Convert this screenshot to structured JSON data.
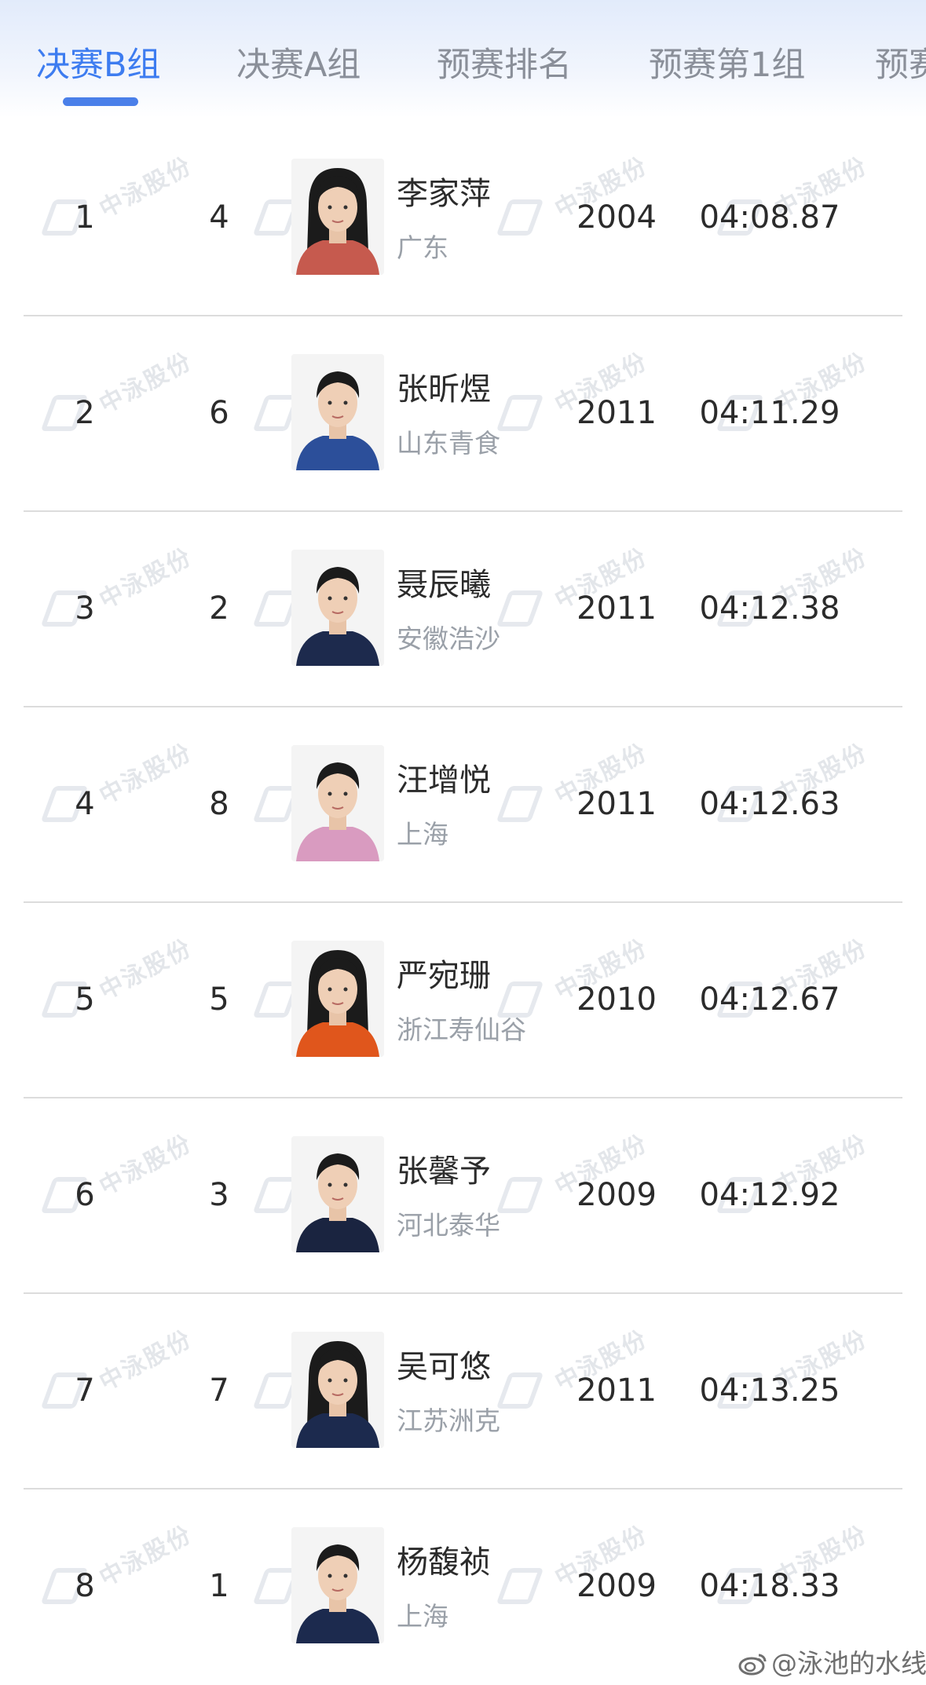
{
  "tabs": [
    {
      "label": "决赛B组",
      "active": true
    },
    {
      "label": "决赛A组",
      "active": false
    },
    {
      "label": "预赛排名",
      "active": false
    },
    {
      "label": "预赛第1组",
      "active": false
    },
    {
      "label": "预赛",
      "active": false
    }
  ],
  "watermark": {
    "text": "中泳股份"
  },
  "rows": [
    {
      "rank": "1",
      "lane": "4",
      "name": "李家萍",
      "team": "广东",
      "year": "2004",
      "time": "04:08.87",
      "shirt": "#c65a4e",
      "hair": "long"
    },
    {
      "rank": "2",
      "lane": "6",
      "name": "张昕煜",
      "team": "山东青食",
      "year": "2011",
      "time": "04:11.29",
      "shirt": "#2c4f9a",
      "hair": "short"
    },
    {
      "rank": "3",
      "lane": "2",
      "name": "聂辰曦",
      "team": "安徽浩沙",
      "year": "2011",
      "time": "04:12.38",
      "shirt": "#1d2a4d",
      "hair": "short"
    },
    {
      "rank": "4",
      "lane": "8",
      "name": "汪增悦",
      "team": "上海",
      "year": "2011",
      "time": "04:12.63",
      "shirt": "#d99bc0",
      "hair": "short"
    },
    {
      "rank": "5",
      "lane": "5",
      "name": "严宛珊",
      "team": "浙江寿仙谷",
      "year": "2010",
      "time": "04:12.67",
      "shirt": "#e0561c",
      "hair": "long"
    },
    {
      "rank": "6",
      "lane": "3",
      "name": "张馨予",
      "team": "河北泰华",
      "year": "2009",
      "time": "04:12.92",
      "shirt": "#1a2440",
      "hair": "short"
    },
    {
      "rank": "7",
      "lane": "7",
      "name": "吴可悠",
      "team": "江苏洲克",
      "year": "2011",
      "time": "04:13.25",
      "shirt": "#1c2a4e",
      "hair": "long"
    },
    {
      "rank": "8",
      "lane": "1",
      "name": "杨馥祯",
      "team": "上海",
      "year": "2009",
      "time": "04:18.33",
      "shirt": "#1c2a4e",
      "hair": "short"
    }
  ],
  "footer": {
    "weibo_handle": "@泳池的水线"
  }
}
